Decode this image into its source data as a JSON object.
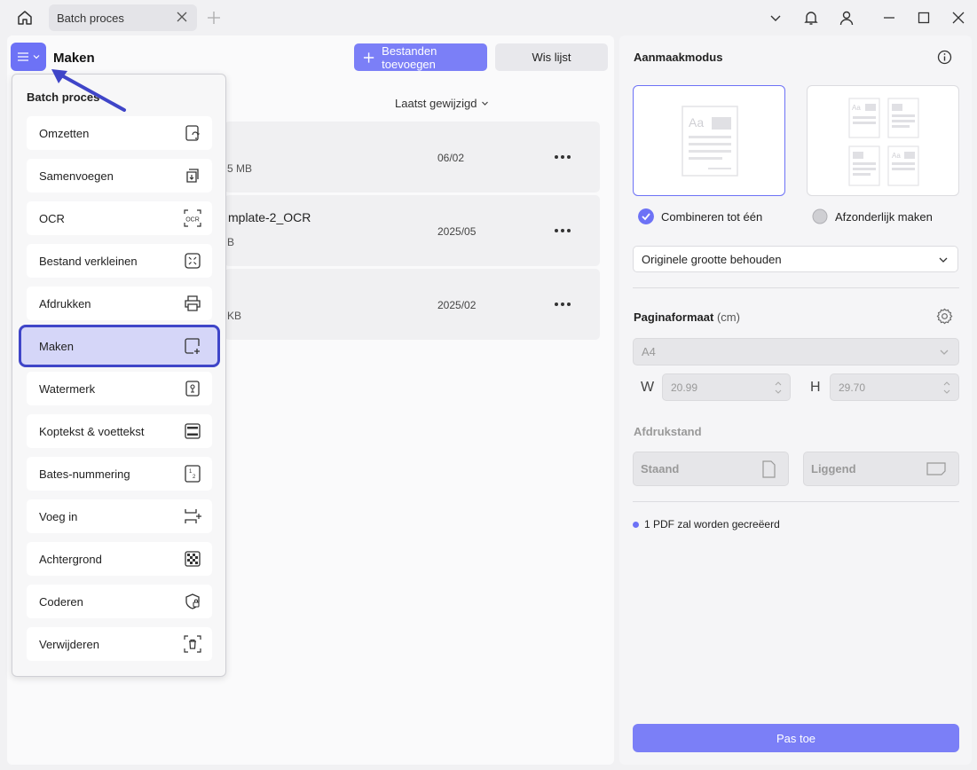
{
  "titlebar": {
    "tab_label": "Batch proces"
  },
  "toolbar": {
    "section_title": "Maken",
    "add_files_label": "Bestanden toevoegen",
    "clear_list_label": "Wis lijst",
    "sort_label": "Laatst gewijzigd"
  },
  "files": [
    {
      "name": "",
      "size": "5 MB",
      "date": "06/02"
    },
    {
      "name": "mplate-2_OCR",
      "size": "B",
      "date": "2025/05"
    },
    {
      "name": "",
      "size": "KB",
      "date": "2025/02"
    }
  ],
  "dropdown": {
    "title": "Batch proces",
    "items": [
      {
        "label": "Omzetten",
        "icon": "convert-icon"
      },
      {
        "label": "Samenvoegen",
        "icon": "merge-icon"
      },
      {
        "label": "OCR",
        "icon": "ocr-icon"
      },
      {
        "label": "Bestand verkleinen",
        "icon": "compress-icon"
      },
      {
        "label": "Afdrukken",
        "icon": "printer-icon"
      },
      {
        "label": "Maken",
        "icon": "create-icon",
        "selected": true
      },
      {
        "label": "Watermerk",
        "icon": "watermark-icon"
      },
      {
        "label": "Koptekst & voettekst",
        "icon": "header-footer-icon"
      },
      {
        "label": "Bates-nummering",
        "icon": "bates-icon"
      },
      {
        "label": "Voeg in",
        "icon": "insert-icon"
      },
      {
        "label": "Achtergrond",
        "icon": "background-icon"
      },
      {
        "label": "Coderen",
        "icon": "encrypt-icon"
      },
      {
        "label": "Verwijderen",
        "icon": "delete-icon"
      }
    ]
  },
  "settings": {
    "mode_title": "Aanmaakmodus",
    "combine_label": "Combineren tot één",
    "separate_label": "Afzonderlijk maken",
    "size_option": "Originele grootte behouden",
    "page_format_label": "Paginaformaat",
    "page_format_unit": "(cm)",
    "paper": "A4",
    "w_label": "W",
    "w_value": "20.99",
    "h_label": "H",
    "h_value": "29.70",
    "orientation_label": "Afdrukstand",
    "portrait_label": "Staand",
    "landscape_label": "Liggend",
    "status_text": "1 PDF zal worden gecreëerd",
    "apply_label": "Pas toe"
  },
  "colors": {
    "accent": "#6d72f6",
    "selection_border": "#3f45c8"
  }
}
